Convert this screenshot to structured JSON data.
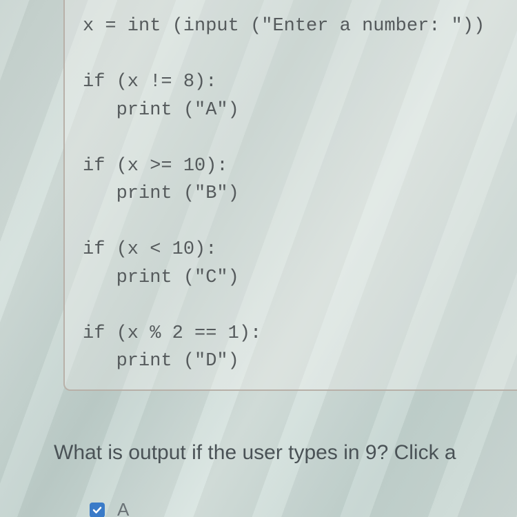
{
  "code": {
    "line1": "x = int (input (\"Enter a number: \"))",
    "blank1": "",
    "line2": "if (x != 8):",
    "line3": "   print (\"A\")",
    "blank2": "",
    "line4": "if (x >= 10):",
    "line5": "   print (\"B\")",
    "blank3": "",
    "line6": "if (x < 10):",
    "line7": "   print (\"C\")",
    "blank4": "",
    "line8": "if (x % 2 == 1):",
    "line9": "   print (\"D\")"
  },
  "question_text": "What is output if the user types in 9? Click a",
  "answer": {
    "label": "A",
    "checked": true
  }
}
